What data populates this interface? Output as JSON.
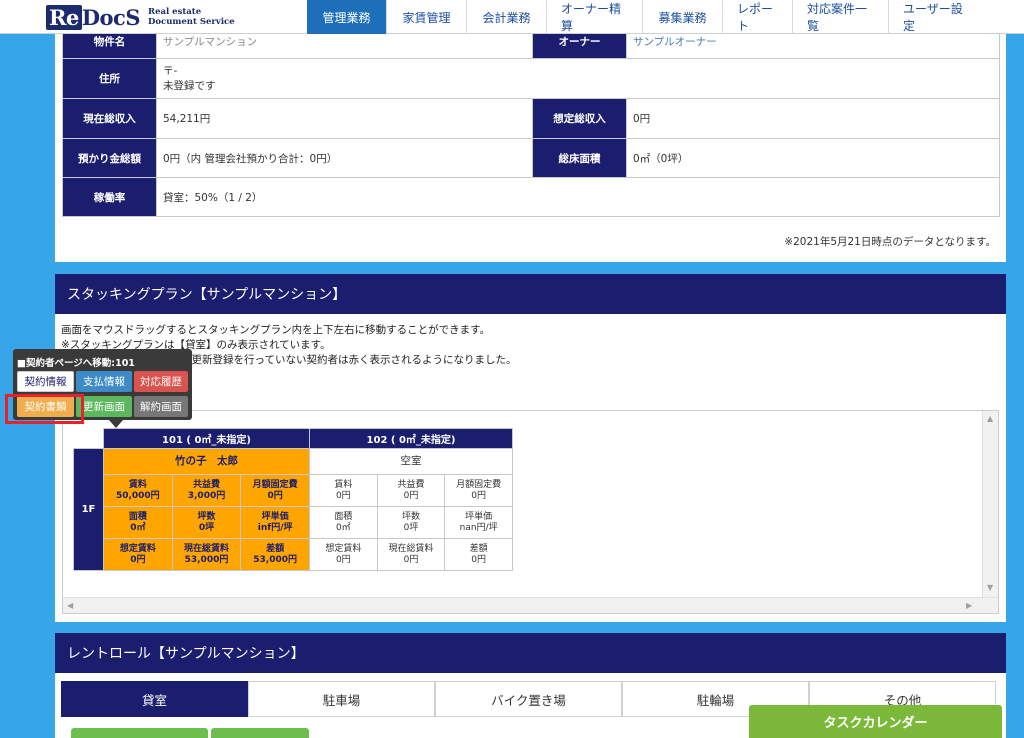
{
  "header": {
    "logo_mark": "ReDocS",
    "logo_sub_1": "Real estate",
    "logo_sub_2": "Document Service",
    "nav": [
      "管理業務",
      "家賃管理",
      "会計業務",
      "オーナー精算",
      "募集業務",
      "レポート",
      "対応案件一覧",
      "ユーザー設定"
    ],
    "active_nav": "管理業務"
  },
  "property_info": {
    "top_row": {
      "label_left": "物件名",
      "value_left": "サンプルマンション",
      "label_right": "オーナー",
      "value_right": "サンプルオーナー"
    },
    "address_label": "住所",
    "address_line1": "〒-",
    "address_line2": "未登録です",
    "current_income_label": "現在総収入",
    "current_income_value": "54,211円",
    "assumed_income_label": "想定総収入",
    "assumed_income_value": "0円",
    "deposit_label": "預かり金総額",
    "deposit_value": "0円（内 管理会社預かり合計：0円）",
    "floor_area_label": "総床面積",
    "floor_area_value": "0㎡（0坪）",
    "occupancy_label": "稼働率",
    "occupancy_value": "貸室：50%（1 / 2）",
    "data_note": "※2021年5月21日時点のデータとなります。"
  },
  "stacking_plan": {
    "title": "スタッキングプラン【サンプルマンション】",
    "desc_1": "画面をマウスドラッグするとスタッキングプラン内を上下左右に移動することができます。",
    "desc_2": "※スタッキングプランは【貸室】のみ表示されています。",
    "desc_3": "※契約終了日の3ヶ月前で、更新登録を行っていない契約者は赤く表示されるようになりました。",
    "floor": "1F",
    "rooms": [
      {
        "header": "101 ( 0㎡_未指定)",
        "tenant": "竹の子　太郎",
        "cells": [
          [
            "賃料",
            "50,000円"
          ],
          [
            "共益費",
            "3,000円"
          ],
          [
            "月額固定費",
            "0円"
          ],
          [
            "面積",
            "0㎡"
          ],
          [
            "坪数",
            "0坪"
          ],
          [
            "坪単価",
            "inf円/坪"
          ],
          [
            "想定賃料",
            "0円"
          ],
          [
            "現在総賃料",
            "53,000円"
          ],
          [
            "差額",
            "53,000円"
          ]
        ]
      },
      {
        "header": "102 ( 0㎡_未指定)",
        "tenant": "空室",
        "cells": [
          [
            "賃料",
            "0円"
          ],
          [
            "共益費",
            "0円"
          ],
          [
            "月額固定費",
            "0円"
          ],
          [
            "面積",
            "0㎡"
          ],
          [
            "坪数",
            "0坪"
          ],
          [
            "坪単価",
            "nan円/坪"
          ],
          [
            "想定賃料",
            "0円"
          ],
          [
            "現在総賃料",
            "0円"
          ],
          [
            "差額",
            "0円"
          ]
        ]
      }
    ]
  },
  "popup": {
    "title": "■契約者ページへ移動:101",
    "buttons": [
      "契約情報",
      "支払情報",
      "対応履歴",
      "契約書類",
      "更新画面",
      "解約画面"
    ],
    "colors": [
      "#ffffff",
      "#3d8bc6",
      "#d9534f",
      "#f0ad4e",
      "#5cb85c",
      "#777777"
    ]
  },
  "rent_roll": {
    "title": "レントロール【サンプルマンション】",
    "tabs": [
      "貸室",
      "駐車場",
      "バイク置き場",
      "駐輪場",
      "その他"
    ],
    "active_tab": "貸室"
  },
  "task_calendar": "タスクカレンダー",
  "colors": {
    "navy": "#1b1e6e",
    "orange": "#ffa500",
    "sky": "#37a6e8",
    "green": "#7cb93a"
  }
}
